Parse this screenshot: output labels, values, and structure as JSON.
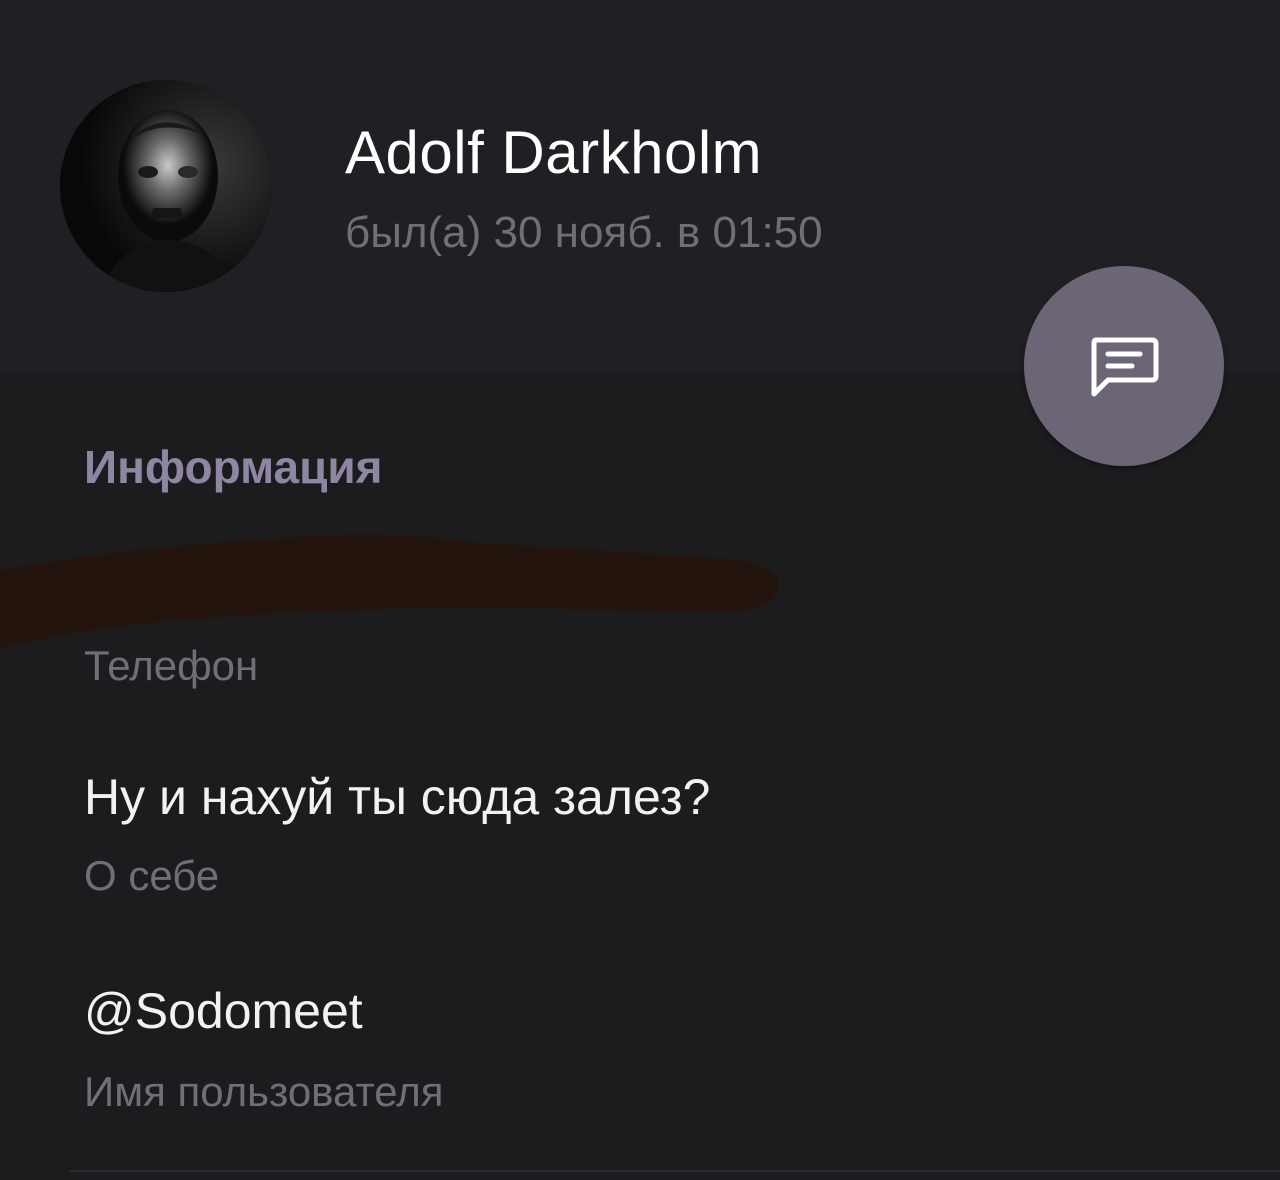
{
  "profile": {
    "name": "Adolf Darkholm",
    "last_seen": "был(а) 30 нояб. в 01:50",
    "avatar_icon": "user-photo-avatar"
  },
  "message_button": {
    "icon": "message-icon",
    "color": "#6b6576"
  },
  "info": {
    "section_title": "Информация",
    "phone": {
      "value_redacted": true,
      "label": "Телефон"
    },
    "bio": {
      "value": "Ну и нахуй ты сюда залез?",
      "label": "О себе"
    },
    "username": {
      "value": "@Sodomeet",
      "label": "Имя пользователя"
    }
  },
  "colors": {
    "background": "#1c1c1f",
    "header_background": "#202024",
    "accent": "#8e86a3",
    "secondary_text": "#6f6f78",
    "redaction_mark": "#23150d"
  }
}
